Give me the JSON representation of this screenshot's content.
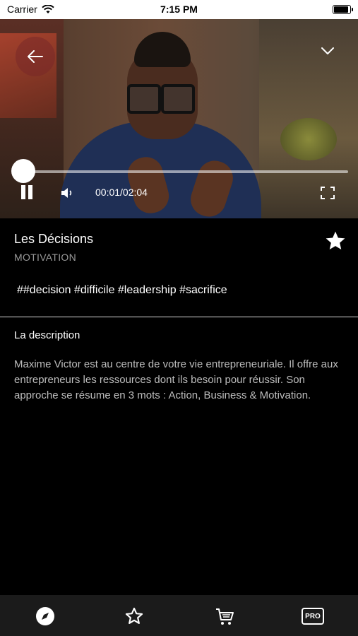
{
  "status_bar": {
    "carrier": "Carrier",
    "time": "7:15 PM"
  },
  "video": {
    "current_time": "00:01/02:04",
    "progress": 0.008
  },
  "content": {
    "title": "Les Décisions",
    "category": "MOTIVATION",
    "tags": "##decision #difficile #leadership #sacrifice",
    "description_heading": "La description",
    "description": "Maxime Victor est au centre de votre vie entrepreneuriale. Il offre aux entrepreneurs les ressources dont ils besoin pour réussir. Son approche se résume en 3 mots : Action, Business & Motivation."
  },
  "tabbar": {
    "pro_label": "PRO",
    "items": [
      "compass-icon",
      "star-icon",
      "cart-icon",
      "pro-icon"
    ]
  }
}
